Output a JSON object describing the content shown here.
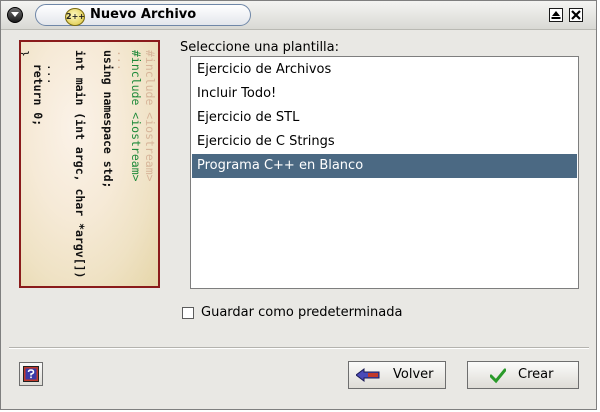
{
  "window": {
    "title": "Nuevo Archivo",
    "app_icon_text": "2++"
  },
  "banner": {
    "code_lines": [
      "#include <iostream>",
      "#include <iostream>",
      "...",
      "using namespace std;",
      "",
      "int main (int argc, char *argv[]) {",
      "",
      "  ...",
      "  return 0;",
      "}"
    ]
  },
  "template_list": {
    "label": "Seleccione una plantilla:",
    "items": [
      "Ejercicio de Archivos",
      "Incluir Todo!",
      "Ejercicio de STL",
      "Ejercicio de C Strings",
      "Programa C++ en Blanco"
    ],
    "selected": "Programa C++ en Blanco"
  },
  "default_checkbox": {
    "label": "Guardar como predeterminada",
    "checked": false
  },
  "buttons": {
    "back": "Volver",
    "create": "Crear"
  },
  "colors": {
    "selection": "#4b6983",
    "banner_border": "#8a1b1b",
    "check_green": "#2a9a2a"
  }
}
